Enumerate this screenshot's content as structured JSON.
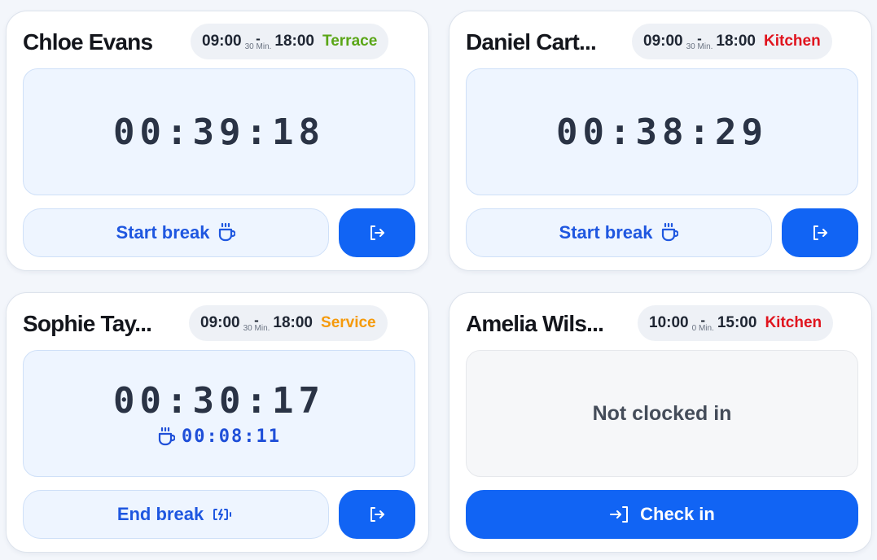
{
  "colors": {
    "accent": "#1164f4",
    "terrace": "#5aa617",
    "kitchen": "#e0141e",
    "service": "#f59a0b"
  },
  "cards": [
    {
      "name": "Chloe Evans",
      "shift_start": "09:00",
      "shift_end": "18:00",
      "break_dash": "-",
      "break_minutes": "30 Min.",
      "area": "Terrace",
      "timer": "00:39:18",
      "break_button_label": "Start break",
      "break_icon": "coffee-cup-icon",
      "checkout_icon": "logout-icon"
    },
    {
      "name": "Daniel Cart...",
      "shift_start": "09:00",
      "shift_end": "18:00",
      "break_dash": "-",
      "break_minutes": "30 Min.",
      "area": "Kitchen",
      "timer": "00:38:29",
      "break_button_label": "Start break",
      "break_icon": "coffee-cup-icon",
      "checkout_icon": "logout-icon"
    },
    {
      "name": "Sophie Tay...",
      "shift_start": "09:00",
      "shift_end": "18:00",
      "break_dash": "-",
      "break_minutes": "30 Min.",
      "area": "Service",
      "timer": "00:30:17",
      "break_timer": "00:08:11",
      "break_button_label": "End break",
      "break_icon": "battery-charging-icon",
      "checkout_icon": "logout-icon"
    },
    {
      "name": "Amelia Wils...",
      "shift_start": "10:00",
      "shift_end": "15:00",
      "break_dash": "-",
      "break_minutes": "0 Min.",
      "area": "Kitchen",
      "status_message": "Not clocked in",
      "checkin_label": "Check in",
      "checkin_icon": "login-icon"
    }
  ]
}
